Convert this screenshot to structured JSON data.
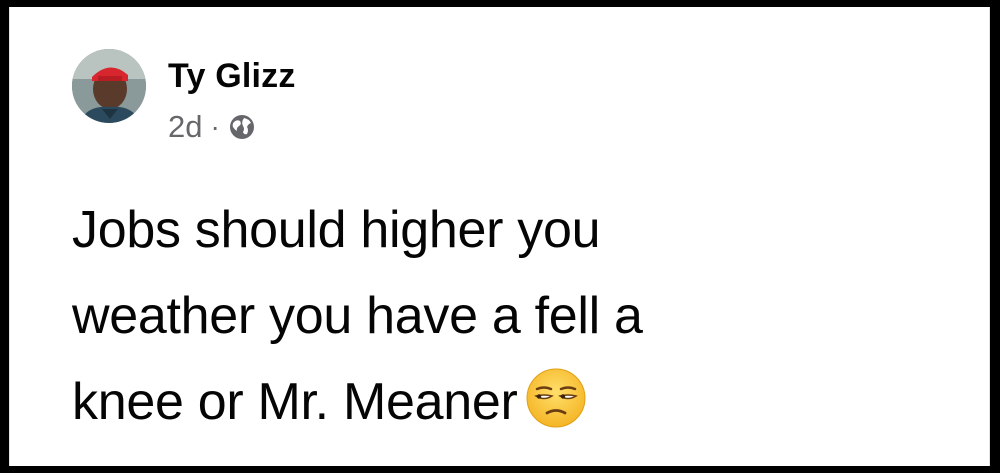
{
  "post": {
    "author_name": "Ty Glizz",
    "timestamp": "2d",
    "separator": "·",
    "audience_icon": "globe-icon",
    "text_lines": [
      "Jobs should higher you",
      "weather you have a fell a",
      "knee or Mr. Meaner"
    ],
    "emoji": "unamused-face-emoji"
  },
  "colors": {
    "background_frame": "#000000",
    "card": "#ffffff",
    "name_text": "#050505",
    "meta_text": "#65676b",
    "emoji_face": "#ffcc3d"
  }
}
